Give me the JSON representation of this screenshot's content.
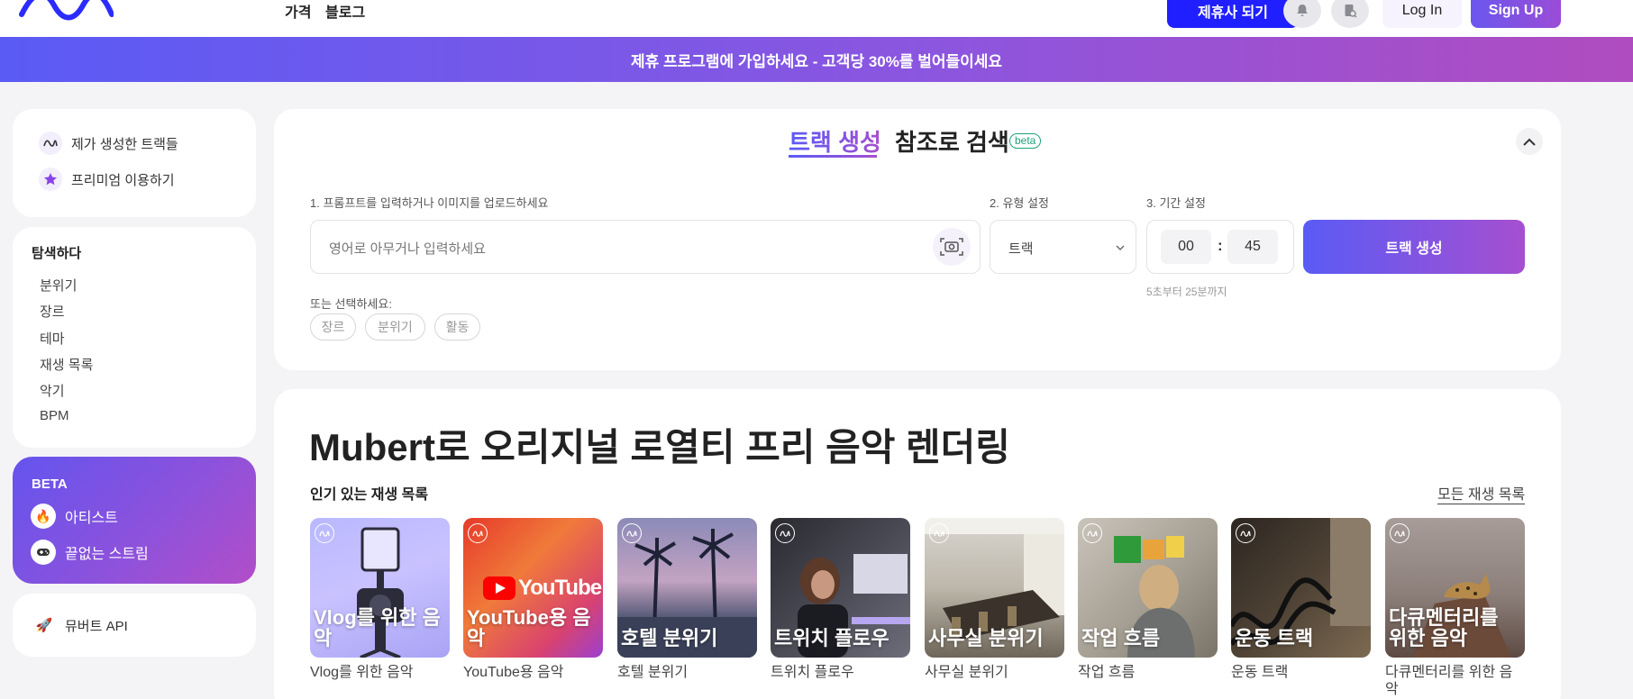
{
  "nav": {
    "links": [
      "가격",
      "블로그"
    ],
    "partner_button": "제휴사 되기",
    "login": "Log In",
    "signup": "Sign Up",
    "icons": [
      "bell-icon",
      "document-search-icon"
    ]
  },
  "banner": "제휴 프로그램에 가입하세요 - 고객당 30%를 벌어들이세요",
  "sidebar": {
    "top": [
      {
        "label": "제가 생성한 트랙들",
        "icon": "wave-icon"
      },
      {
        "label": "프리미엄 이용하기",
        "icon": "star-icon"
      }
    ],
    "explore_title": "탐색하다",
    "explore": [
      "분위기",
      "장르",
      "테마",
      "재생 목록",
      "악기",
      "BPM"
    ],
    "beta": {
      "title": "BETA",
      "items": [
        {
          "label": "아티스트",
          "icon": "fire-icon"
        },
        {
          "label": "끝없는 스트림",
          "icon": "gamepad-icon"
        }
      ]
    },
    "api": {
      "label": "뮤버트 API",
      "icon": "rocket-icon"
    }
  },
  "generator": {
    "tab_active": "트랙 생성",
    "tab_other": "참조로 검색",
    "beta_badge": "beta",
    "step1": "1. 프롬프트를 입력하거나 이미지를 업로드하세요",
    "step2": "2. 유형 설정",
    "step3": "3. 기간 설정",
    "prompt_placeholder": "영어로 아무거나 입력하세요",
    "type_value": "트랙",
    "minutes": "00",
    "seconds": "45",
    "duration_hint": "5초부터 25분까지",
    "generate_button": "트랙 생성",
    "or_label": "또는 선택하세요:",
    "chips": [
      "장르",
      "분위기",
      "활동"
    ]
  },
  "content": {
    "headline": "Mubert로 오리지널 로열티 프리 음악 렌더링",
    "popular_label": "인기 있는 재생 목록",
    "all_link": "모든 재생 목록",
    "playlists": [
      {
        "title": "Vlog를 위한 음악",
        "caption": "Vlog를 위한 음악"
      },
      {
        "title": "YouTube용 음악",
        "caption": "YouTube용 음악"
      },
      {
        "title": "호텔 분위기",
        "caption": "호텔 분위기"
      },
      {
        "title": "트위치 플로우",
        "caption": "트위치 플로우"
      },
      {
        "title": "사무실 분위기",
        "caption": "사무실 분위기"
      },
      {
        "title": "작업 흐름",
        "caption": "작업 흐름"
      },
      {
        "title": "운동 트랙",
        "caption": "운동 트랙"
      },
      {
        "title": "다큐멘터리를 위한 음악",
        "caption": "다큐멘터리를 위한 음악"
      }
    ],
    "youtube_logo_text": "YouTube"
  },
  "colors": {
    "accent": "#1f1fff",
    "gradient_start": "#5a5bf5",
    "gradient_end": "#a64fd0",
    "beta_green": "#1ca37a"
  }
}
